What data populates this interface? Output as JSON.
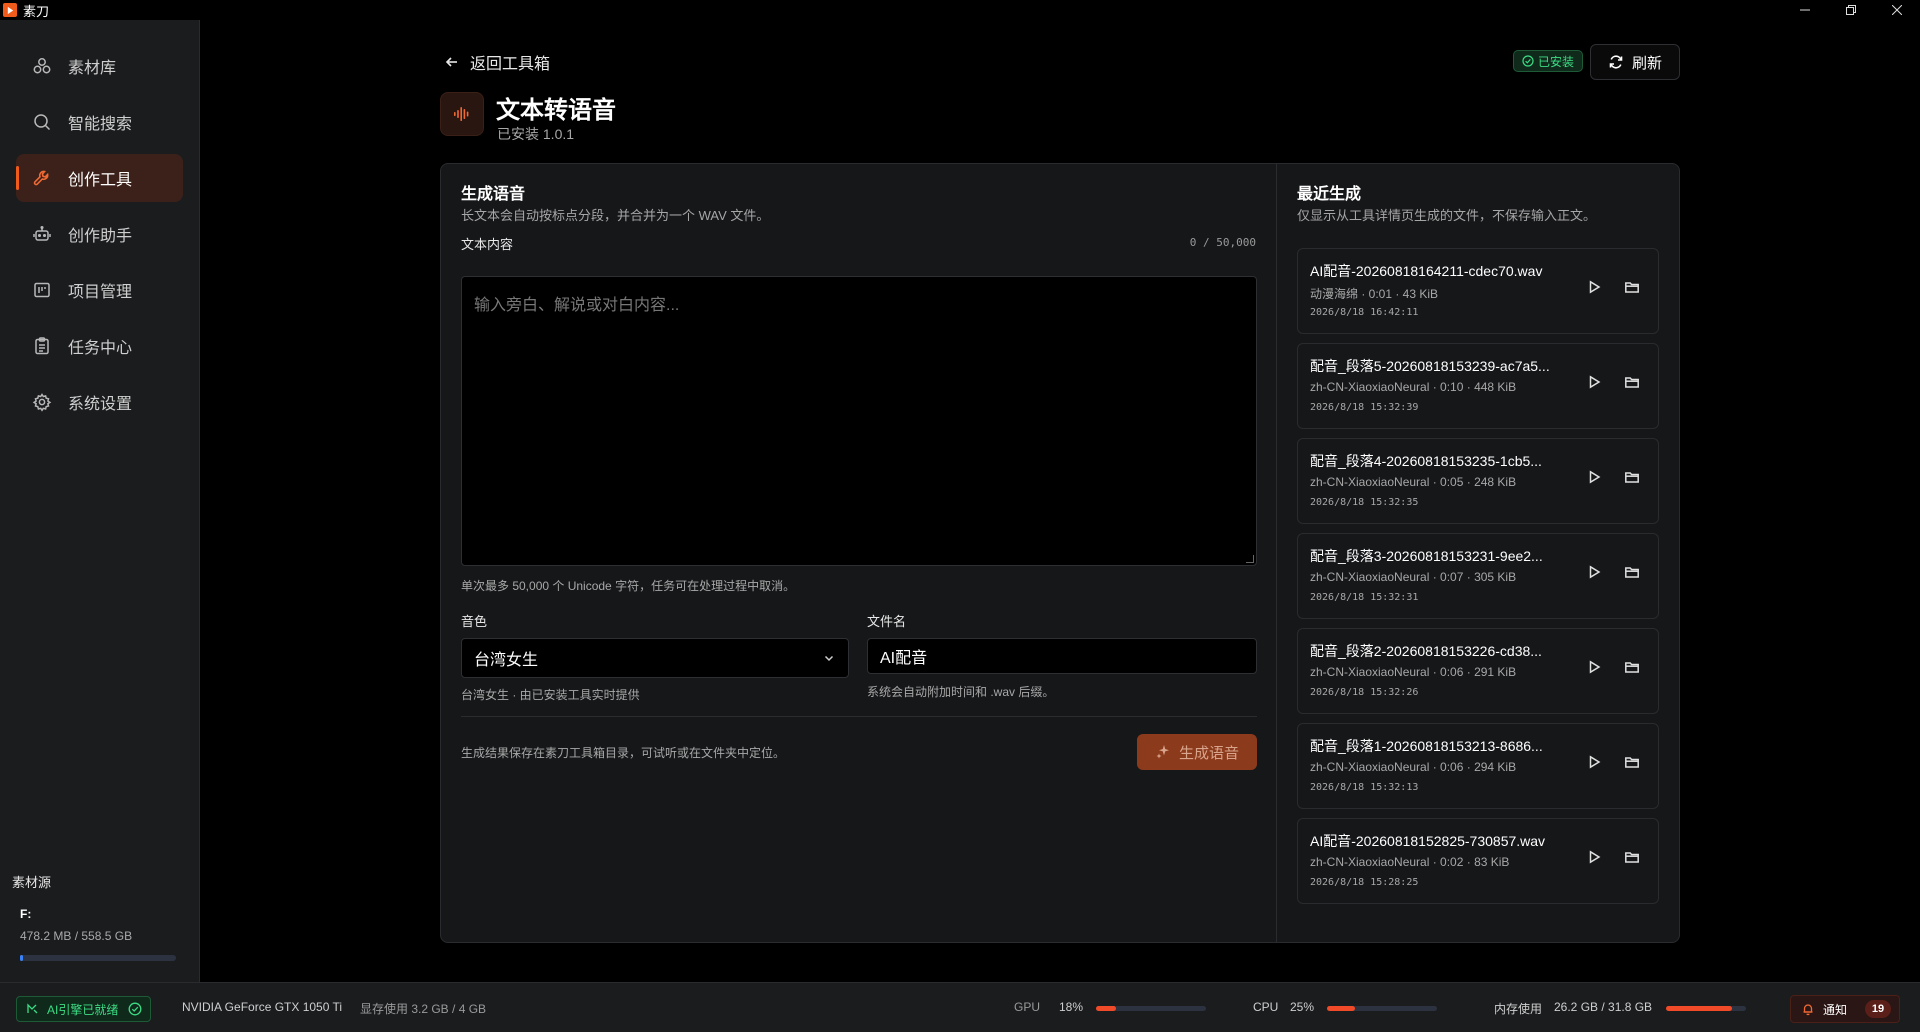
{
  "app": {
    "title": "素刀"
  },
  "sidebar": {
    "items": [
      {
        "label": "素材库",
        "icon": "asset-library-icon"
      },
      {
        "label": "智能搜索",
        "icon": "search-icon"
      },
      {
        "label": "创作工具",
        "icon": "wrench-icon",
        "active": true
      },
      {
        "label": "创作助手",
        "icon": "robot-icon"
      },
      {
        "label": "项目管理",
        "icon": "project-board-icon"
      },
      {
        "label": "任务中心",
        "icon": "clipboard-icon"
      },
      {
        "label": "系统设置",
        "icon": "gear-icon"
      }
    ],
    "source": {
      "title": "素材源",
      "drive": "F:",
      "usage": "478.2 MB / 558.5 GB",
      "usage_fraction": 0.001
    }
  },
  "header": {
    "back_label": "返回工具箱",
    "installed_badge": "已安装",
    "refresh_label": "刷新",
    "tool_title": "文本转语音",
    "tool_version": "已安装 1.0.1"
  },
  "generate": {
    "title": "生成语音",
    "subtitle": "长文本会自动按标点分段，并合并为一个 WAV 文件。",
    "text_label": "文本内容",
    "char_count": "0 / 50,000",
    "text_placeholder": "输入旁白、解说或对白内容...",
    "text_hint": "单次最多 50,000 个 Unicode 字符，任务可在处理过程中取消。",
    "voice_label": "音色",
    "voice_value": "台湾女生",
    "voice_hint": "台湾女生 · 由已安装工具实时提供",
    "filename_label": "文件名",
    "filename_value": "AI配音",
    "filename_hint": "系统会自动附加时间和 .wav 后缀。",
    "footer_note": "生成结果保存在素刀工具箱目录，可试听或在文件夹中定位。",
    "generate_button": "生成语音"
  },
  "recent": {
    "title": "最近生成",
    "subtitle": "仅显示从工具详情页生成的文件，不保存输入正文。",
    "files": [
      {
        "name": "AI配音-20260818164211-cdec70.wav",
        "meta": "动漫海绵 · 0:01 · 43 KiB",
        "time": "2026/8/18 16:42:11"
      },
      {
        "name": "配音_段落5-20260818153239-ac7a5...",
        "meta": "zh-CN-XiaoxiaoNeural · 0:10 · 448 KiB",
        "time": "2026/8/18 15:32:39"
      },
      {
        "name": "配音_段落4-20260818153235-1cb5...",
        "meta": "zh-CN-XiaoxiaoNeural · 0:05 · 248 KiB",
        "time": "2026/8/18 15:32:35"
      },
      {
        "name": "配音_段落3-20260818153231-9ee2...",
        "meta": "zh-CN-XiaoxiaoNeural · 0:07 · 305 KiB",
        "time": "2026/8/18 15:32:31"
      },
      {
        "name": "配音_段落2-20260818153226-cd38...",
        "meta": "zh-CN-XiaoxiaoNeural · 0:06 · 291 KiB",
        "time": "2026/8/18 15:32:26"
      },
      {
        "name": "配音_段落1-20260818153213-8686...",
        "meta": "zh-CN-XiaoxiaoNeural · 0:06 · 294 KiB",
        "time": "2026/8/18 15:32:13"
      },
      {
        "name": "AI配音-20260818152825-730857.wav",
        "meta": "zh-CN-XiaoxiaoNeural · 0:02 · 83 KiB",
        "time": "2026/8/18 15:28:25"
      }
    ]
  },
  "status": {
    "ai_status": "AI引擎已就绪",
    "gpu_name": "NVIDIA GeForce GTX 1050 Ti",
    "vram_label": "显存使用 3.2 GB / 4 GB",
    "gpu_label": "GPU",
    "gpu_value": "18%",
    "gpu_fraction": 0.18,
    "cpu_label": "CPU",
    "cpu_value": "25%",
    "cpu_fraction": 0.25,
    "mem_label": "内存使用",
    "mem_value": "26.2 GB / 31.8 GB",
    "mem_fraction": 0.82,
    "notify_label": "通知",
    "notify_count": "19"
  },
  "colors": {
    "accent": "#f05a1a",
    "success": "#3ddc84",
    "panel": "#161719",
    "sidebar": "#1b1c1e"
  }
}
